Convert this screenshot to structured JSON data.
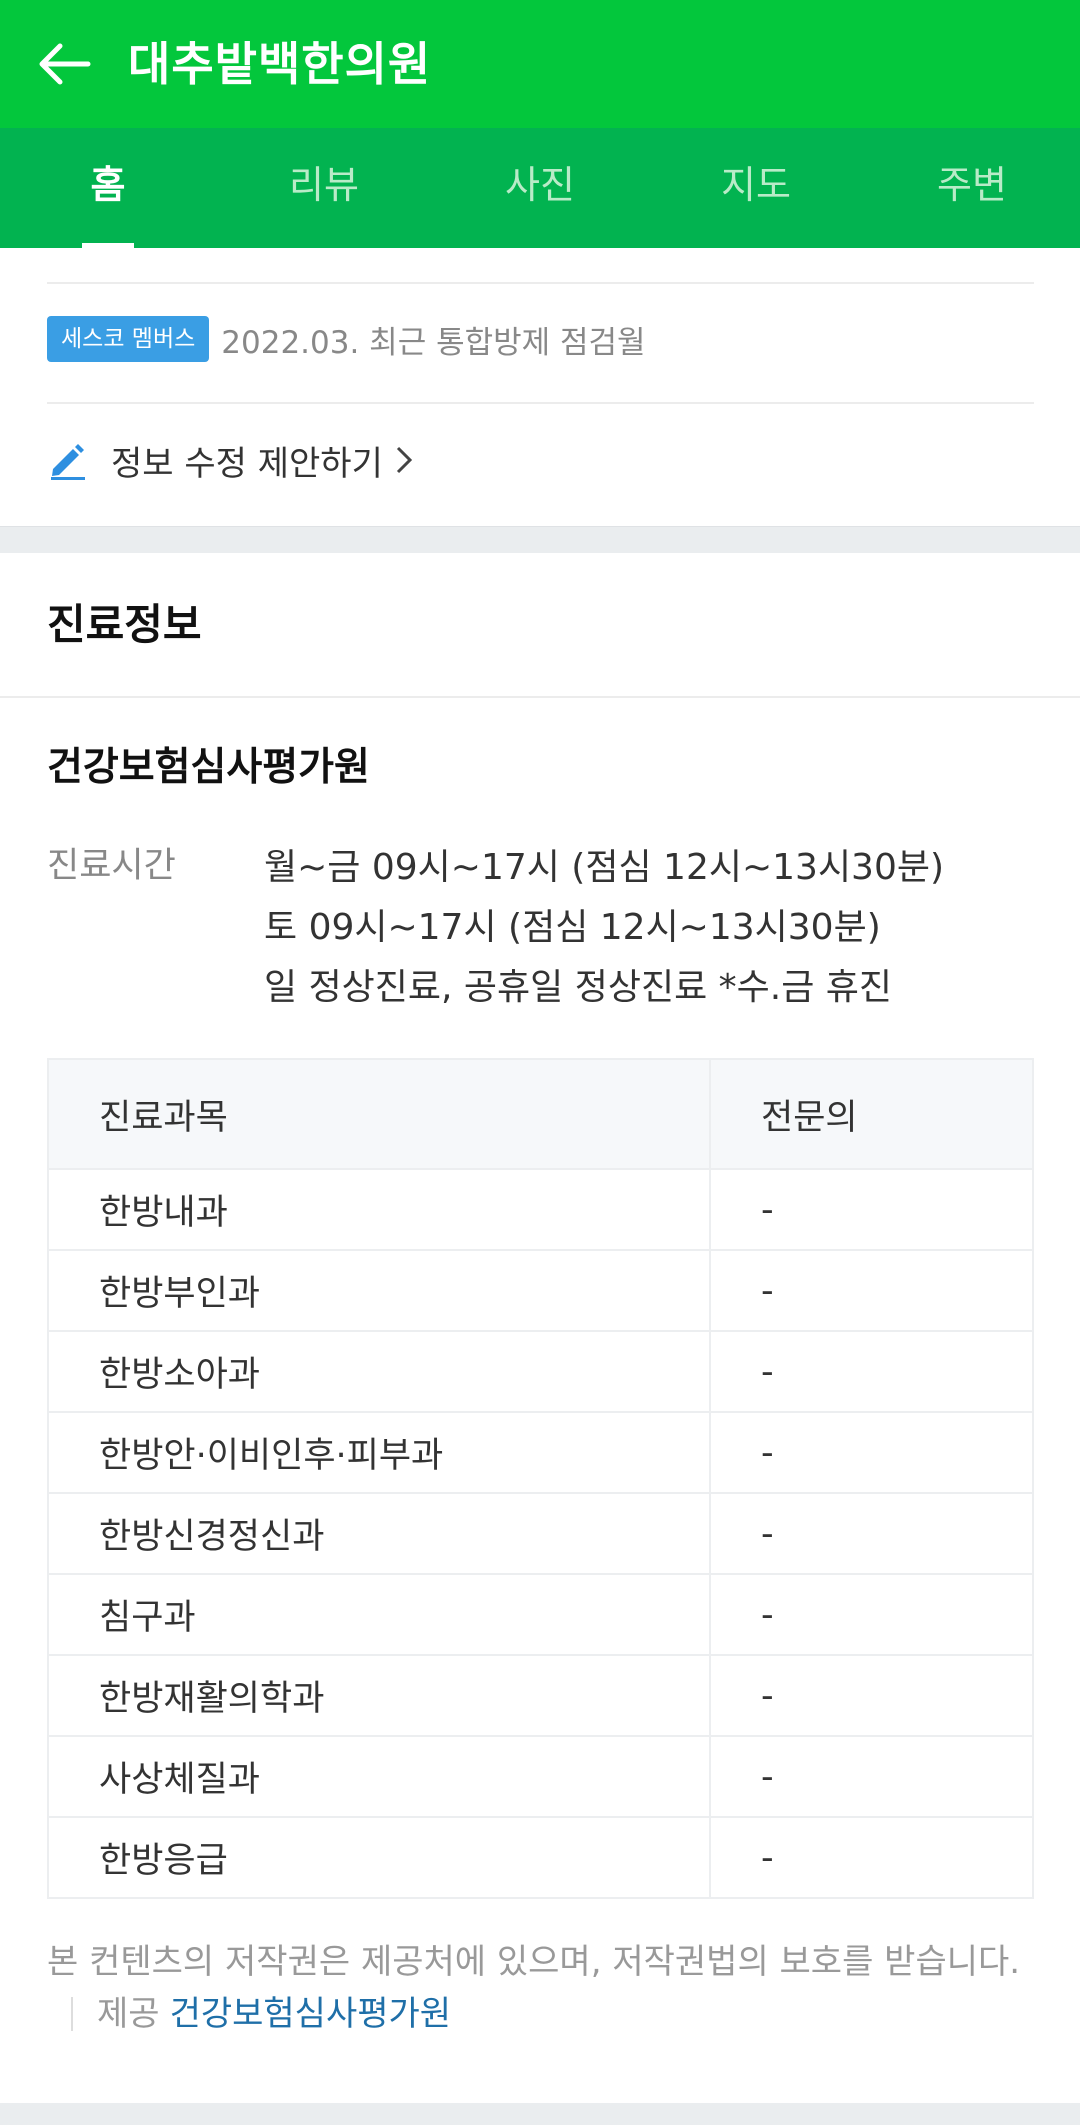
{
  "header": {
    "title": "대추밭백한의원",
    "back_icon": "arrow-left-icon"
  },
  "tabs": [
    {
      "label": "홈",
      "active": true
    },
    {
      "label": "리뷰",
      "active": false
    },
    {
      "label": "사진",
      "active": false
    },
    {
      "label": "지도",
      "active": false
    },
    {
      "label": "주변",
      "active": false
    }
  ],
  "cesco": {
    "badge": "세스코 멤버스",
    "text": "2022.03. 최근 통합방제 점검월"
  },
  "edit": {
    "label": "정보 수정 제안하기",
    "icon": "pencil-icon"
  },
  "section": {
    "title": "진료정보"
  },
  "source": {
    "title": "건강보험심사평가원"
  },
  "hours": {
    "label": "진료시간",
    "lines": [
      "월~금 09시~17시 (점심 12시~13시30분)",
      "토 09시~17시 (점심 12시~13시30분)",
      "일 정상진료, 공휴일 정상진료 *수.금 휴진"
    ]
  },
  "table": {
    "headers": [
      "진료과목",
      "전문의"
    ],
    "rows": [
      [
        "한방내과",
        "-"
      ],
      [
        "한방부인과",
        "-"
      ],
      [
        "한방소아과",
        "-"
      ],
      [
        "한방안·이비인후·피부과",
        "-"
      ],
      [
        "한방신경정신과",
        "-"
      ],
      [
        "침구과",
        "-"
      ],
      [
        "한방재활의학과",
        "-"
      ],
      [
        "사상체질과",
        "-"
      ],
      [
        "한방응급",
        "-"
      ]
    ]
  },
  "footer": {
    "note": "본 컨텐츠의 저작권은 제공처에 있으며, 저작권법의 보호를 받습니다.",
    "provider_label": "제공",
    "provider_name": "건강보험심사평가원"
  },
  "colors": {
    "header_green": "#03c73c",
    "tab_green": "#02b350",
    "badge_blue": "#3a9ee4",
    "link_blue": "#1f6fa8"
  }
}
